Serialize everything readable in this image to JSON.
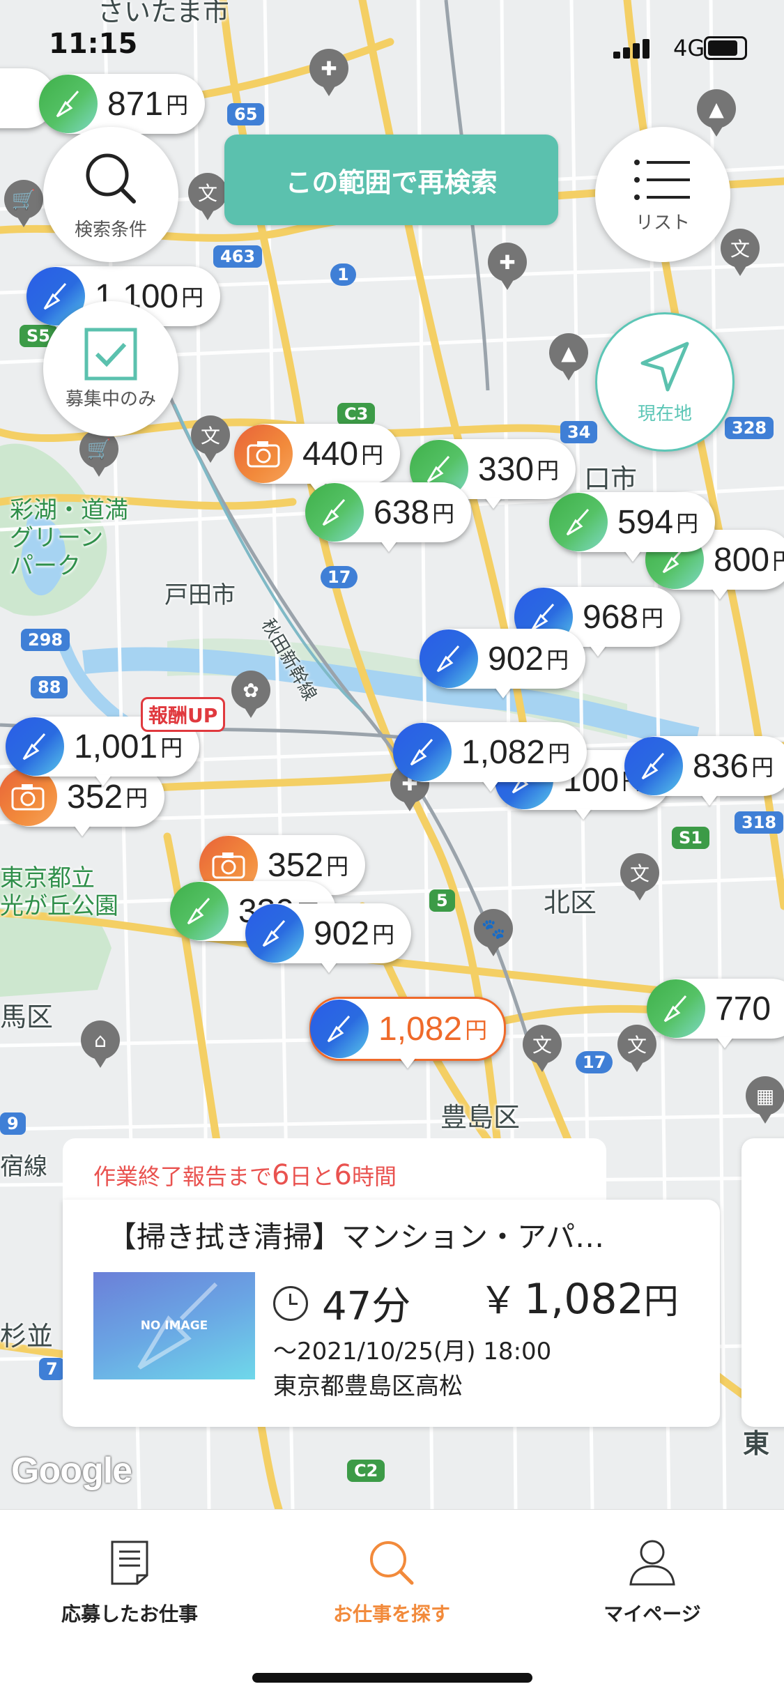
{
  "status_bar": {
    "time": "11:15",
    "network": "4G"
  },
  "map": {
    "places": [
      {
        "id": "saitama",
        "text": "さいたま市"
      },
      {
        "id": "kawaguchi",
        "text": "口市"
      },
      {
        "id": "saiko",
        "text": "彩湖・道満\nグリーン\nパーク"
      },
      {
        "id": "toda",
        "text": "戸田市"
      },
      {
        "id": "shinkansen",
        "text": "秋田新幹線"
      },
      {
        "id": "hikarigaoka",
        "text": "東京都立\n光が丘公園"
      },
      {
        "id": "kita",
        "text": "北区"
      },
      {
        "id": "nerima",
        "text": "馬区"
      },
      {
        "id": "toshima",
        "text": "豊島区"
      },
      {
        "id": "suginami",
        "text": "杉並"
      },
      {
        "id": "shinjuku",
        "text": "宿線"
      },
      {
        "id": "higashi",
        "text": "東"
      }
    ],
    "road_shields": [
      "65",
      "463",
      "C3",
      "1",
      "S5",
      "17",
      "298",
      "88",
      "34",
      "328",
      "S1",
      "318",
      "5",
      "17",
      "C2",
      "7",
      "9"
    ],
    "google_logo": "Google"
  },
  "markers": [
    {
      "id": "m871",
      "type": "green",
      "price": "871",
      "unit": "円"
    },
    {
      "id": "m1100",
      "type": "blue",
      "price": "1,100",
      "unit": "円"
    },
    {
      "id": "m440",
      "type": "orange",
      "price": "440",
      "unit": "円"
    },
    {
      "id": "m330",
      "type": "green",
      "price": "330",
      "unit": "円"
    },
    {
      "id": "m638",
      "type": "green",
      "price": "638",
      "unit": "円"
    },
    {
      "id": "m594",
      "type": "green",
      "price": "594",
      "unit": "円"
    },
    {
      "id": "m800",
      "type": "green",
      "price": "800",
      "unit": "円"
    },
    {
      "id": "m968",
      "type": "blue",
      "price": "968",
      "unit": "円"
    },
    {
      "id": "m902a",
      "type": "blue",
      "price": "902",
      "unit": "円"
    },
    {
      "id": "m1001",
      "type": "blue",
      "price": "1,001",
      "unit": "円"
    },
    {
      "id": "m352a",
      "type": "orange",
      "price": "352",
      "unit": "円"
    },
    {
      "id": "m1082a",
      "type": "blue",
      "price": "1,082",
      "unit": "円"
    },
    {
      "id": "m100",
      "type": "blue",
      "price": "100",
      "unit": "円"
    },
    {
      "id": "m836",
      "type": "blue",
      "price": "836",
      "unit": "円"
    },
    {
      "id": "m352b",
      "type": "orange",
      "price": "352",
      "unit": "円"
    },
    {
      "id": "m330b",
      "type": "green",
      "price": "330",
      "unit": "円"
    },
    {
      "id": "m902b",
      "type": "blue",
      "price": "902",
      "unit": "円"
    },
    {
      "id": "m1082sel",
      "type": "blue",
      "price": "1,082",
      "unit": "円"
    },
    {
      "id": "m770",
      "type": "green",
      "price": "770",
      "unit": ""
    }
  ],
  "badge_up": "報酬UP",
  "controls": {
    "search_conditions": "検索条件",
    "research_button": "この範囲で再検索",
    "list": "リスト",
    "recruiting_only": "募集中のみ",
    "current_location": "現在地"
  },
  "job_card": {
    "deadline_prefix": "作業終了報告まで",
    "days": "6",
    "days_unit": "日と",
    "hours": "6",
    "hours_unit": "時間",
    "title": "【掃き拭き清掃】マンション・アパ…",
    "thumbnail_text": "NO IMAGE",
    "duration": "47分",
    "yen_symbol": "￥",
    "fee": "1,082",
    "fee_unit": "円",
    "deadline_date": "～2021/10/25(月) 18:00",
    "address": "東京都豊島区高松"
  },
  "tab_bar": [
    {
      "id": "applied",
      "label": "応募したお仕事",
      "icon": "document-icon",
      "active": false
    },
    {
      "id": "search",
      "label": "お仕事を探す",
      "icon": "search-icon",
      "active": true
    },
    {
      "id": "mypage",
      "label": "マイページ",
      "icon": "person-icon",
      "active": false
    }
  ],
  "colors": {
    "teal": "#5bc1ae",
    "orange": "#f28a3b",
    "red": "#e9524f",
    "blue": "#2a5de8",
    "green": "#3fb04a"
  }
}
